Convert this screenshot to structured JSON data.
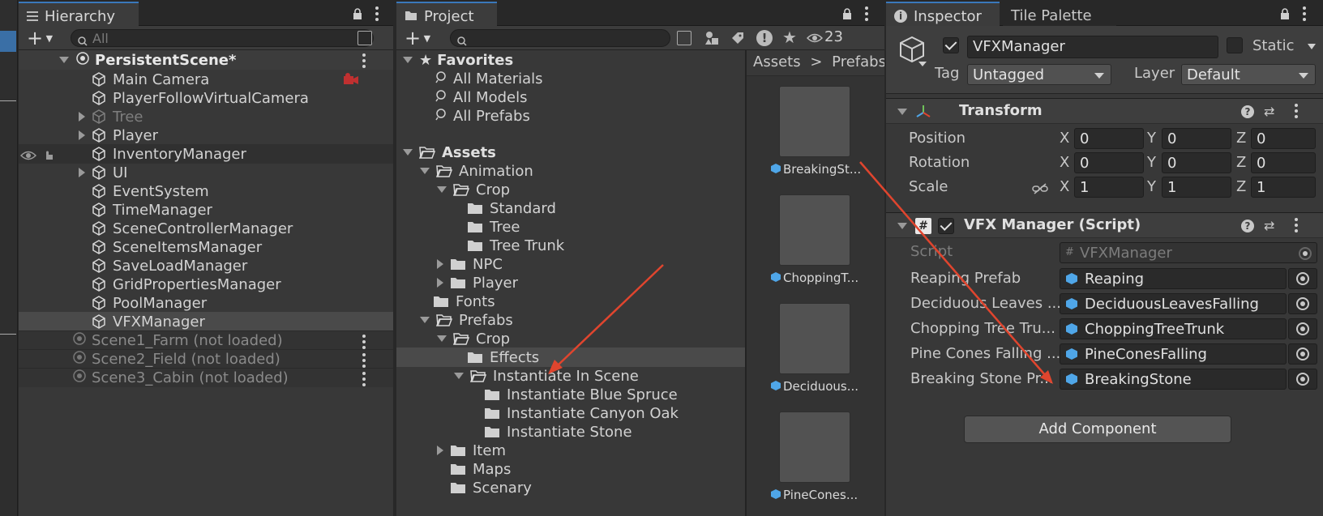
{
  "hierarchy": {
    "tab_label": "Hierarchy",
    "search_placeholder": "All",
    "scene_root": "PersistentScene*",
    "items": [
      {
        "label": "Main Camera"
      },
      {
        "label": "PlayerFollowVirtualCamera"
      },
      {
        "label": "Tree"
      },
      {
        "label": "Player"
      },
      {
        "label": "InventoryManager"
      },
      {
        "label": "UI"
      },
      {
        "label": "EventSystem"
      },
      {
        "label": "TimeManager"
      },
      {
        "label": "SceneControllerManager"
      },
      {
        "label": "SceneItemsManager"
      },
      {
        "label": "SaveLoadManager"
      },
      {
        "label": "GridPropertiesManager"
      },
      {
        "label": "PoolManager"
      },
      {
        "label": "VFXManager"
      }
    ],
    "unloaded_scenes": [
      {
        "label": "Scene1_Farm (not loaded)"
      },
      {
        "label": "Scene2_Field (not loaded)"
      },
      {
        "label": "Scene3_Cabin (not loaded)"
      }
    ]
  },
  "project": {
    "tab_label": "Project",
    "hidden_count": "23",
    "breadcrumb": [
      "Assets",
      "Prefabs"
    ],
    "favorites_label": "Favorites",
    "favorites": [
      "All Materials",
      "All Models",
      "All Prefabs"
    ],
    "tree": [
      {
        "label": "Assets"
      },
      {
        "label": "Animation"
      },
      {
        "label": "Crop"
      },
      {
        "label": "Standard"
      },
      {
        "label": "Tree"
      },
      {
        "label": "Tree Trunk"
      },
      {
        "label": "NPC"
      },
      {
        "label": "Player"
      },
      {
        "label": "Fonts"
      },
      {
        "label": "Prefabs"
      },
      {
        "label": "Crop"
      },
      {
        "label": "Effects"
      },
      {
        "label": "Instantiate In Scene"
      },
      {
        "label": "Instantiate Blue Spruce"
      },
      {
        "label": "Instantiate Canyon Oak"
      },
      {
        "label": "Instantiate Stone"
      },
      {
        "label": "Item"
      },
      {
        "label": "Maps"
      },
      {
        "label": "Scenary"
      }
    ],
    "assets": [
      {
        "label": "BreakingSt..."
      },
      {
        "label": "ChoppingT..."
      },
      {
        "label": "Deciduous..."
      },
      {
        "label": "PineCones..."
      }
    ]
  },
  "inspector": {
    "tab_label": "Inspector",
    "tab2_label": "Tile Palette",
    "object_name": "VFXManager",
    "static_label": "Static",
    "tag_label": "Tag",
    "tag_value": "Untagged",
    "layer_label": "Layer",
    "layer_value": "Default",
    "transform": {
      "title": "Transform",
      "rows": [
        {
          "label": "Position",
          "x": "0",
          "y": "0",
          "z": "0"
        },
        {
          "label": "Rotation",
          "x": "0",
          "y": "0",
          "z": "0"
        },
        {
          "label": "Scale",
          "x": "1",
          "y": "1",
          "z": "1"
        }
      ],
      "axis_x": "X",
      "axis_y": "Y",
      "axis_z": "Z"
    },
    "script_component": {
      "title": "VFX Manager (Script)",
      "script_label": "Script",
      "script_value": "VFXManager",
      "fields": [
        {
          "label": "Reaping Prefab",
          "value": "Reaping"
        },
        {
          "label": "Deciduous Leaves ...",
          "value": "DeciduousLeavesFalling"
        },
        {
          "label": "Chopping Tree Tru...",
          "value": "ChoppingTreeTrunk"
        },
        {
          "label": "Pine Cones Falling ...",
          "value": "PineConesFalling"
        },
        {
          "label": "Breaking Stone Pr...",
          "value": "BreakingStone"
        }
      ]
    },
    "add_component_label": "Add Component"
  },
  "colors": {
    "accent": "#3a79bb",
    "arrow": "#e0452e",
    "prefab_blue": "#4fa6e8"
  }
}
